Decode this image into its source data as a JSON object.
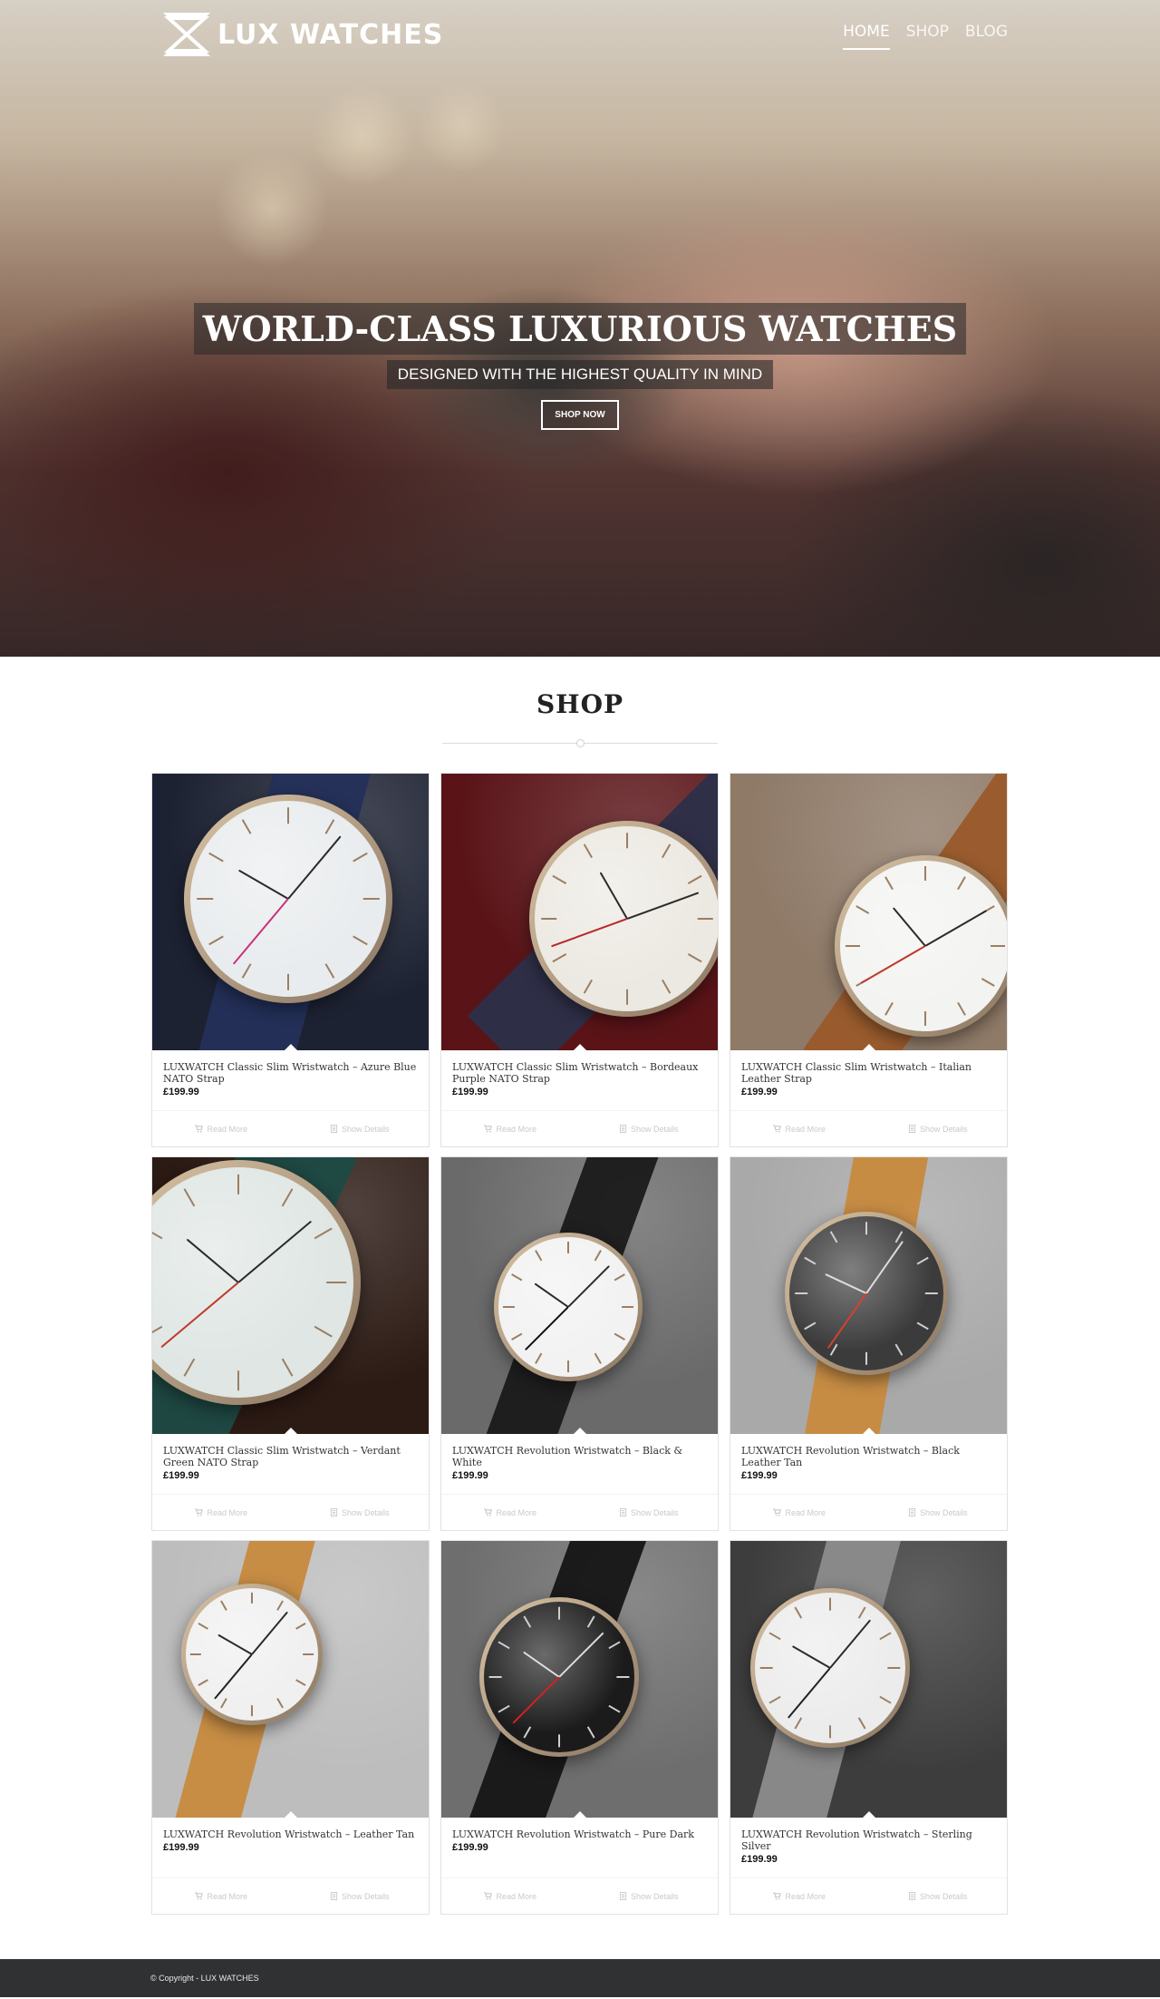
{
  "header": {
    "brand": "LUX WATCHES",
    "nav": [
      {
        "label": "HOME",
        "active": true
      },
      {
        "label": "SHOP",
        "active": false
      },
      {
        "label": "BLOG",
        "active": false
      }
    ]
  },
  "hero": {
    "title": "WORLD-CLASS LUXURIOUS WATCHES",
    "subtitle": "DESIGNED WITH THE HIGHEST QUALITY IN MIND",
    "cta": "SHOP NOW"
  },
  "shop": {
    "heading": "SHOP",
    "action_labels": {
      "read_more": "Read More",
      "show_details": "Show Details"
    },
    "products": [
      {
        "title": "LUXWATCH Classic Slim Wristwatch – Azure Blue NATO Strap",
        "price": "£199.99",
        "image": "watch-azure-blue-nato",
        "bg": "#1d2233",
        "strap": "#24305a",
        "face": "#e9ecee",
        "accent": "#c8327a"
      },
      {
        "title": "LUXWATCH Classic Slim Wristwatch – Bordeaux Purple NATO Strap",
        "price": "£199.99",
        "image": "watch-bordeaux-purple-nato",
        "bg": "#5a1418",
        "strap": "#2c2f4a",
        "face": "#ece9e2",
        "accent": "#b8282a"
      },
      {
        "title": "LUXWATCH Classic Slim Wristwatch – Italian Leather Strap",
        "price": "£199.99",
        "image": "watch-italian-leather",
        "bg": "#8f7a68",
        "strap": "#9a5a2a",
        "face": "#f3f3f1",
        "accent": "#c0392b"
      },
      {
        "title": "LUXWATCH Classic Slim Wristwatch – Verdant Green NATO Strap",
        "price": "£199.99",
        "image": "watch-verdant-green-nato",
        "bg": "#2c1a14",
        "strap": "#1d4a44",
        "face": "#dfe6e3",
        "accent": "#c0392b"
      },
      {
        "title": "LUXWATCH Revolution Wristwatch – Black & White",
        "price": "£199.99",
        "image": "watch-black-white",
        "bg": "#6a6a6a",
        "strap": "#1a1a1a",
        "face": "#f2f2f2",
        "accent": "#111111"
      },
      {
        "title": "LUXWATCH Revolution Wristwatch – Black Leather Tan",
        "price": "£199.99",
        "image": "watch-black-leather-tan",
        "bg": "#a9a9a9",
        "strap": "#c78a3e",
        "face": "#3b3b3b",
        "accent": "#d64030"
      },
      {
        "title": "LUXWATCH Revolution Wristwatch – Leather Tan",
        "price": "£199.99",
        "image": "watch-leather-tan",
        "bg": "#bdbdbd",
        "strap": "#c78a3e",
        "face": "#f0f0f0",
        "accent": "#222222"
      },
      {
        "title": "LUXWATCH Revolution Wristwatch – Pure Dark",
        "price": "£199.99",
        "image": "watch-pure-dark",
        "bg": "#6e6e6e",
        "strap": "#151515",
        "face": "#1b1b1b",
        "accent": "#d62020"
      },
      {
        "title": "LUXWATCH Revolution Wristwatch – Sterling Silver",
        "price": "£199.99",
        "image": "watch-sterling-silver",
        "bg": "#3d3d3d",
        "strap": "#8c8c8c",
        "face": "#ececec",
        "accent": "#222222"
      }
    ]
  },
  "footer": {
    "copyright": "© Copyright - LUX WATCHES"
  }
}
